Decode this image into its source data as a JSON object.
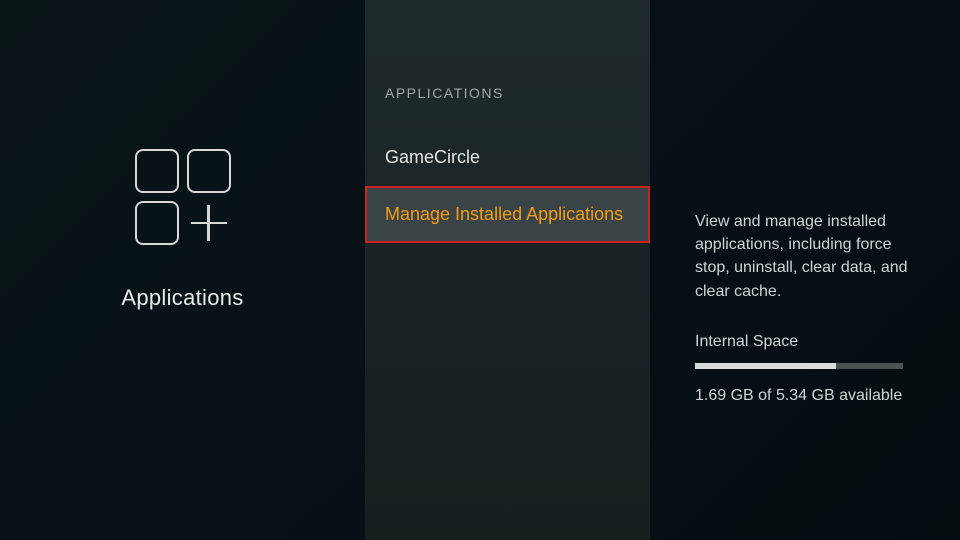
{
  "left": {
    "title": "Applications"
  },
  "middle": {
    "section_header": "APPLICATIONS",
    "items": [
      {
        "label": "GameCircle"
      },
      {
        "label": "Manage Installed Applications"
      }
    ]
  },
  "right": {
    "description": "View and manage installed applications, including force stop, uninstall, clear data, and clear cache.",
    "storage_label": "Internal Space",
    "storage_used_gb": 3.65,
    "storage_total_gb": 5.34,
    "storage_fill_percent": 68,
    "storage_text": "1.69 GB of 5.34 GB available"
  }
}
